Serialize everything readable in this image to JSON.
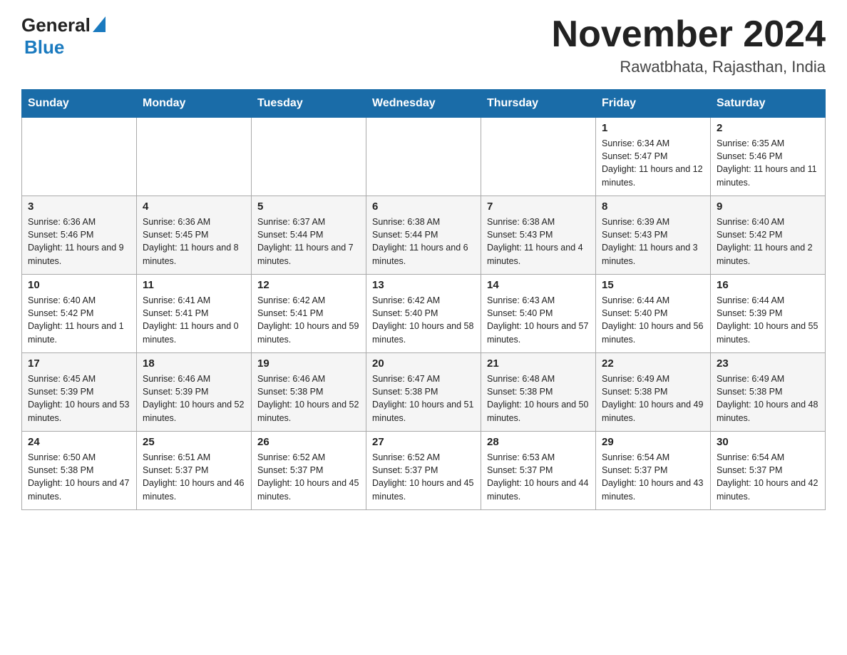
{
  "header": {
    "logo_general": "General",
    "logo_blue": "Blue",
    "month_title": "November 2024",
    "location": "Rawatbhata, Rajasthan, India"
  },
  "days_of_week": [
    "Sunday",
    "Monday",
    "Tuesday",
    "Wednesday",
    "Thursday",
    "Friday",
    "Saturday"
  ],
  "weeks": [
    [
      {
        "day": "",
        "info": ""
      },
      {
        "day": "",
        "info": ""
      },
      {
        "day": "",
        "info": ""
      },
      {
        "day": "",
        "info": ""
      },
      {
        "day": "",
        "info": ""
      },
      {
        "day": "1",
        "info": "Sunrise: 6:34 AM\nSunset: 5:47 PM\nDaylight: 11 hours and 12 minutes."
      },
      {
        "day": "2",
        "info": "Sunrise: 6:35 AM\nSunset: 5:46 PM\nDaylight: 11 hours and 11 minutes."
      }
    ],
    [
      {
        "day": "3",
        "info": "Sunrise: 6:36 AM\nSunset: 5:46 PM\nDaylight: 11 hours and 9 minutes."
      },
      {
        "day": "4",
        "info": "Sunrise: 6:36 AM\nSunset: 5:45 PM\nDaylight: 11 hours and 8 minutes."
      },
      {
        "day": "5",
        "info": "Sunrise: 6:37 AM\nSunset: 5:44 PM\nDaylight: 11 hours and 7 minutes."
      },
      {
        "day": "6",
        "info": "Sunrise: 6:38 AM\nSunset: 5:44 PM\nDaylight: 11 hours and 6 minutes."
      },
      {
        "day": "7",
        "info": "Sunrise: 6:38 AM\nSunset: 5:43 PM\nDaylight: 11 hours and 4 minutes."
      },
      {
        "day": "8",
        "info": "Sunrise: 6:39 AM\nSunset: 5:43 PM\nDaylight: 11 hours and 3 minutes."
      },
      {
        "day": "9",
        "info": "Sunrise: 6:40 AM\nSunset: 5:42 PM\nDaylight: 11 hours and 2 minutes."
      }
    ],
    [
      {
        "day": "10",
        "info": "Sunrise: 6:40 AM\nSunset: 5:42 PM\nDaylight: 11 hours and 1 minute."
      },
      {
        "day": "11",
        "info": "Sunrise: 6:41 AM\nSunset: 5:41 PM\nDaylight: 11 hours and 0 minutes."
      },
      {
        "day": "12",
        "info": "Sunrise: 6:42 AM\nSunset: 5:41 PM\nDaylight: 10 hours and 59 minutes."
      },
      {
        "day": "13",
        "info": "Sunrise: 6:42 AM\nSunset: 5:40 PM\nDaylight: 10 hours and 58 minutes."
      },
      {
        "day": "14",
        "info": "Sunrise: 6:43 AM\nSunset: 5:40 PM\nDaylight: 10 hours and 57 minutes."
      },
      {
        "day": "15",
        "info": "Sunrise: 6:44 AM\nSunset: 5:40 PM\nDaylight: 10 hours and 56 minutes."
      },
      {
        "day": "16",
        "info": "Sunrise: 6:44 AM\nSunset: 5:39 PM\nDaylight: 10 hours and 55 minutes."
      }
    ],
    [
      {
        "day": "17",
        "info": "Sunrise: 6:45 AM\nSunset: 5:39 PM\nDaylight: 10 hours and 53 minutes."
      },
      {
        "day": "18",
        "info": "Sunrise: 6:46 AM\nSunset: 5:39 PM\nDaylight: 10 hours and 52 minutes."
      },
      {
        "day": "19",
        "info": "Sunrise: 6:46 AM\nSunset: 5:38 PM\nDaylight: 10 hours and 52 minutes."
      },
      {
        "day": "20",
        "info": "Sunrise: 6:47 AM\nSunset: 5:38 PM\nDaylight: 10 hours and 51 minutes."
      },
      {
        "day": "21",
        "info": "Sunrise: 6:48 AM\nSunset: 5:38 PM\nDaylight: 10 hours and 50 minutes."
      },
      {
        "day": "22",
        "info": "Sunrise: 6:49 AM\nSunset: 5:38 PM\nDaylight: 10 hours and 49 minutes."
      },
      {
        "day": "23",
        "info": "Sunrise: 6:49 AM\nSunset: 5:38 PM\nDaylight: 10 hours and 48 minutes."
      }
    ],
    [
      {
        "day": "24",
        "info": "Sunrise: 6:50 AM\nSunset: 5:38 PM\nDaylight: 10 hours and 47 minutes."
      },
      {
        "day": "25",
        "info": "Sunrise: 6:51 AM\nSunset: 5:37 PM\nDaylight: 10 hours and 46 minutes."
      },
      {
        "day": "26",
        "info": "Sunrise: 6:52 AM\nSunset: 5:37 PM\nDaylight: 10 hours and 45 minutes."
      },
      {
        "day": "27",
        "info": "Sunrise: 6:52 AM\nSunset: 5:37 PM\nDaylight: 10 hours and 45 minutes."
      },
      {
        "day": "28",
        "info": "Sunrise: 6:53 AM\nSunset: 5:37 PM\nDaylight: 10 hours and 44 minutes."
      },
      {
        "day": "29",
        "info": "Sunrise: 6:54 AM\nSunset: 5:37 PM\nDaylight: 10 hours and 43 minutes."
      },
      {
        "day": "30",
        "info": "Sunrise: 6:54 AM\nSunset: 5:37 PM\nDaylight: 10 hours and 42 minutes."
      }
    ]
  ]
}
